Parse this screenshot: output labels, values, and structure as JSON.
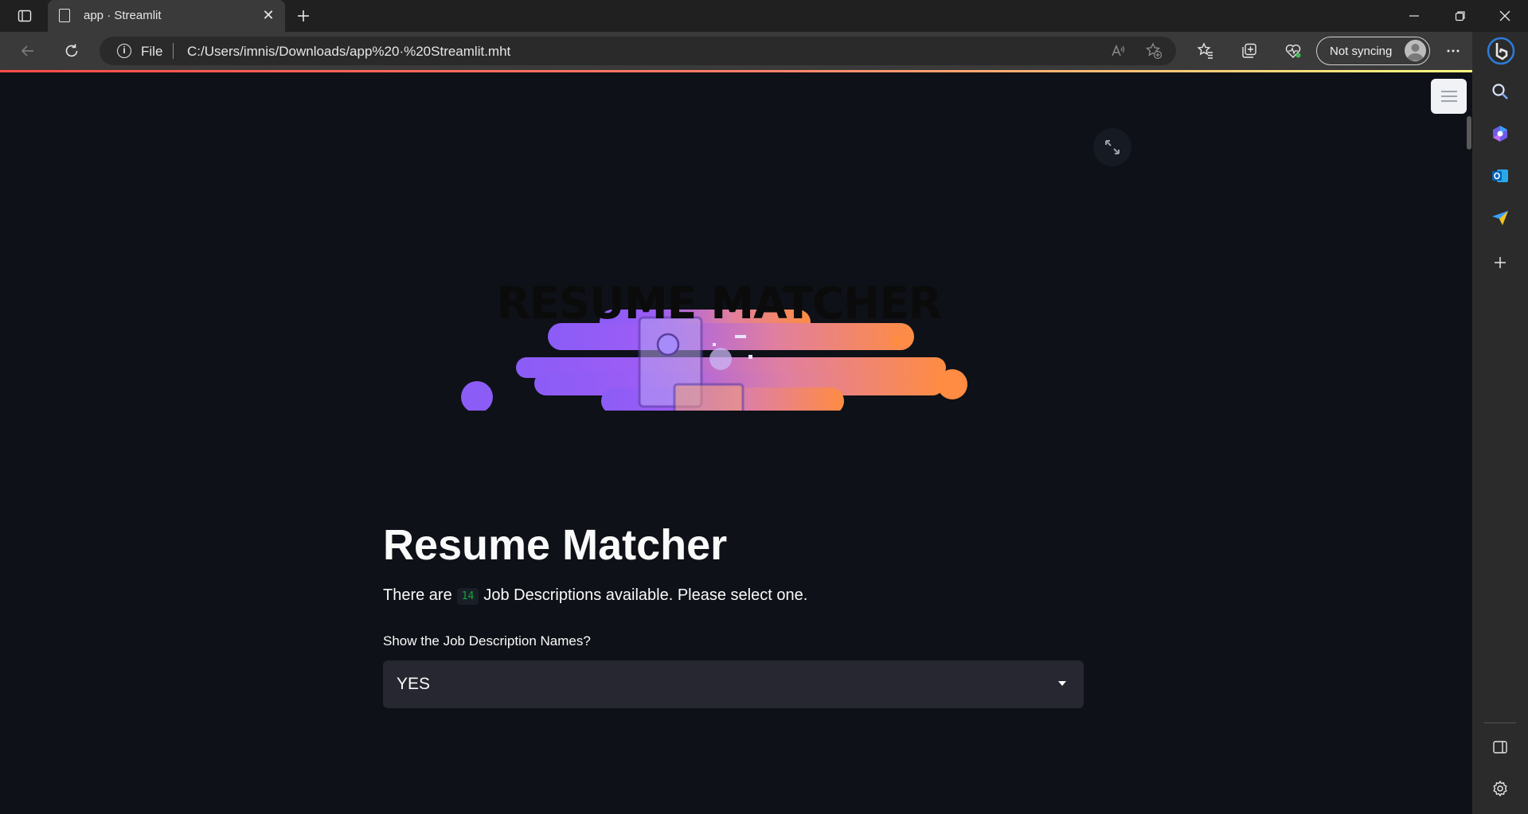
{
  "browser": {
    "tab_title": "app · Streamlit",
    "address_scheme": "File",
    "address_url": "C:/Users/imnis/Downloads/app%20·%20Streamlit.mht",
    "sync_status": "Not syncing"
  },
  "app": {
    "banner_text": "RESUME MATCHER",
    "title": "Resume Matcher",
    "info_prefix": "There are",
    "job_count": "14",
    "info_suffix": "Job Descriptions available. Please select one.",
    "select_label": "Show the Job Description Names?",
    "select_value": "YES"
  },
  "colors": {
    "page_bg": "#0e1117",
    "select_bg": "#262730",
    "count_green": "#09ab3b",
    "banner_gradient_start": "#8b5cf6",
    "banner_gradient_end": "#ff8c42"
  }
}
